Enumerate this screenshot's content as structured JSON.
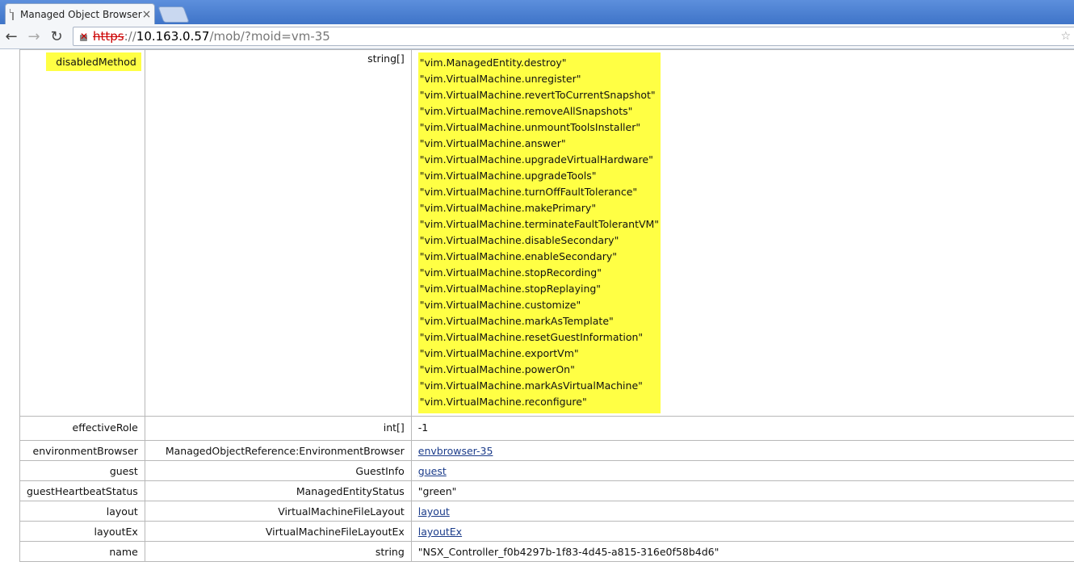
{
  "browser": {
    "tab_title": "Managed Object Browser",
    "tab_close": "×",
    "url_scheme": "https",
    "url_sep": "://",
    "url_host": "10.163.0.57",
    "url_path": "/mob/?moid=vm-35"
  },
  "rows": [
    {
      "name": "disabledMethod",
      "type": "string[]",
      "values": [
        "\"vim.ManagedEntity.destroy\"",
        "\"vim.VirtualMachine.unregister\"",
        "\"vim.VirtualMachine.revertToCurrentSnapshot\"",
        "\"vim.VirtualMachine.removeAllSnapshots\"",
        "\"vim.VirtualMachine.unmountToolsInstaller\"",
        "\"vim.VirtualMachine.answer\"",
        "\"vim.VirtualMachine.upgradeVirtualHardware\"",
        "\"vim.VirtualMachine.upgradeTools\"",
        "\"vim.VirtualMachine.turnOffFaultTolerance\"",
        "\"vim.VirtualMachine.makePrimary\"",
        "\"vim.VirtualMachine.terminateFaultTolerantVM\"",
        "\"vim.VirtualMachine.disableSecondary\"",
        "\"vim.VirtualMachine.enableSecondary\"",
        "\"vim.VirtualMachine.stopRecording\"",
        "\"vim.VirtualMachine.stopReplaying\"",
        "\"vim.VirtualMachine.customize\"",
        "\"vim.VirtualMachine.markAsTemplate\"",
        "\"vim.VirtualMachine.resetGuestInformation\"",
        "\"vim.VirtualMachine.exportVm\"",
        "\"vim.VirtualMachine.powerOn\"",
        "\"vim.VirtualMachine.markAsVirtualMachine\"",
        "\"vim.VirtualMachine.reconfigure\""
      ]
    },
    {
      "name": "effectiveRole",
      "type": "int[]",
      "value": "-1"
    },
    {
      "name": "environmentBrowser",
      "type": "ManagedObjectReference:EnvironmentBrowser",
      "link": "envbrowser-35"
    },
    {
      "name": "guest",
      "type": "GuestInfo",
      "link": "guest"
    },
    {
      "name": "guestHeartbeatStatus",
      "type": "ManagedEntityStatus",
      "value": "\"green\""
    },
    {
      "name": "layout",
      "type": "VirtualMachineFileLayout",
      "link": "layout"
    },
    {
      "name": "layoutEx",
      "type": "VirtualMachineFileLayoutEx",
      "link": "layoutEx"
    },
    {
      "name": "name",
      "type": "string",
      "value": "\"NSX_Controller_f0b4297b-1f83-4d45-a815-316e0f58b4d6\""
    }
  ]
}
